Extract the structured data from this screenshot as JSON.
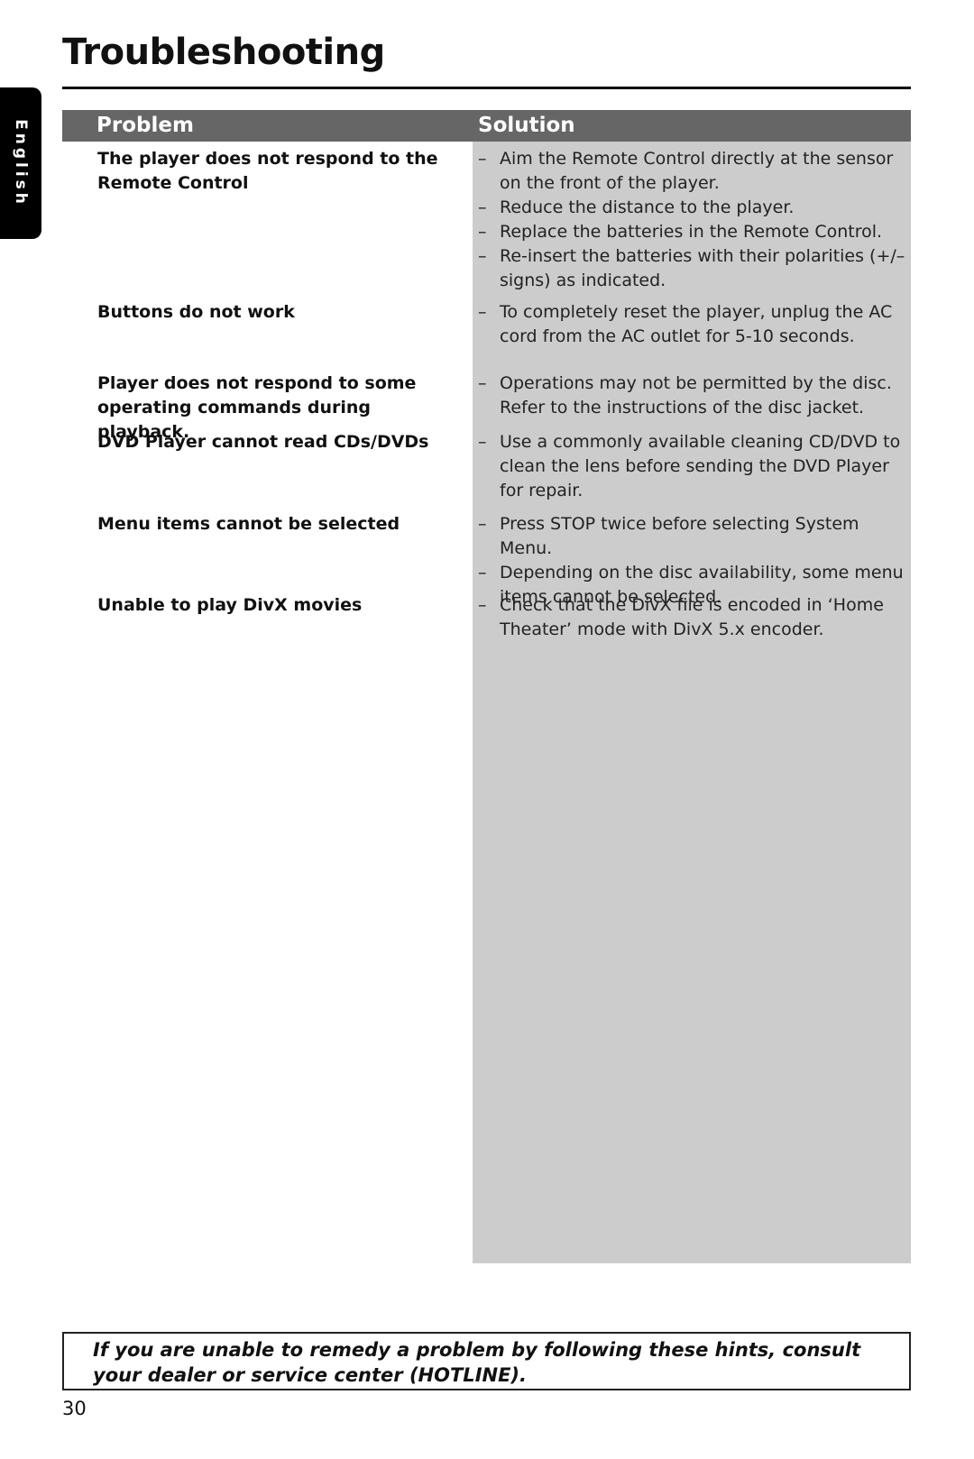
{
  "page": {
    "title": "Troubleshooting",
    "language_tab": "English",
    "page_number": "30"
  },
  "table": {
    "headers": {
      "problem": "Problem",
      "solution": "Solution"
    },
    "rows": [
      {
        "problem": "The player does not respond to the Remote Control",
        "solutions": [
          "Aim the Remote Control directly at the sensor on the front of the player.",
          "Reduce the distance to the player.",
          "Replace the batteries in the Remote Control.",
          "Re-insert the batteries with their polarities (+/– signs) as indicated."
        ]
      },
      {
        "problem": "Buttons do not work",
        "solutions": [
          "To completely reset the player, unplug the AC cord from the AC outlet for 5-10 seconds."
        ]
      },
      {
        "problem": "Player does not respond to some operating commands during playback.",
        "solutions": [
          "Operations may not be permitted by the disc. Refer to the instructions of  the disc jacket."
        ]
      },
      {
        "problem": "DVD Player cannot read CDs/DVDs",
        "solutions": [
          "Use a commonly available cleaning CD/DVD to clean the lens before sending the DVD Player for repair."
        ]
      },
      {
        "problem": "Menu items cannot be selected",
        "solutions": [
          "Press STOP twice before selecting System Menu.",
          "Depending on the disc availability, some menu items cannot be selected."
        ]
      },
      {
        "problem": "Unable to play DivX movies",
        "solutions": [
          "Check that the DivX file is encoded in ‘Home Theater’ mode with DivX 5.x encoder."
        ]
      }
    ],
    "bullet": "–"
  },
  "note": "If you are unable to remedy a problem by following these hints, consult your dealer or service center (HOTLINE).",
  "colors": {
    "header_bar": "#666666",
    "solution_column": "#cccccc",
    "text": "#111111"
  }
}
